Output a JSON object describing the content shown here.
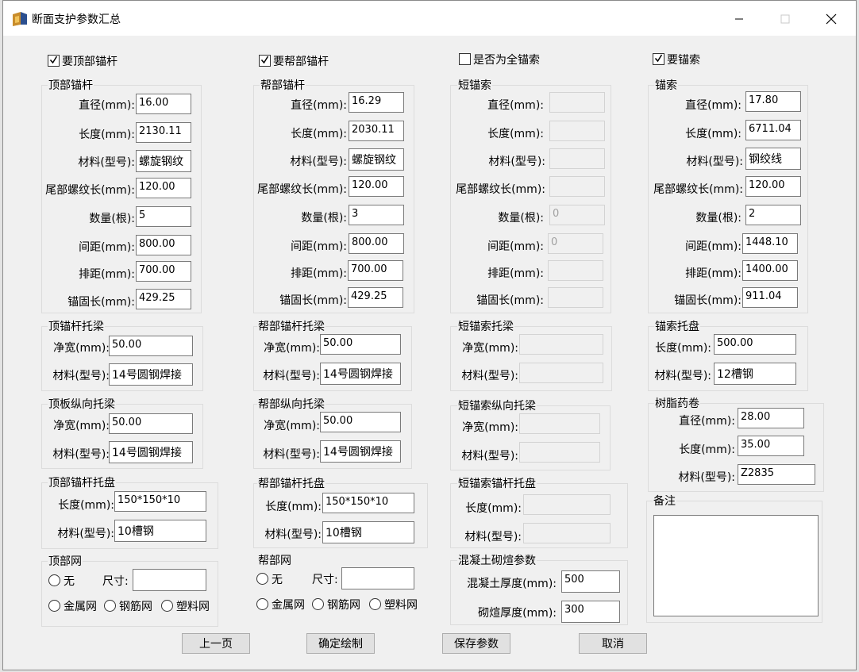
{
  "window": {
    "title": "断面支护参数汇总"
  },
  "checkboxes": {
    "top_bolt": {
      "label": "要顶部锚杆",
      "checked": true
    },
    "side_bolt": {
      "label": "要帮部锚杆",
      "checked": true
    },
    "full_cable": {
      "label": "是否为全锚索",
      "checked": false
    },
    "cable": {
      "label": "要锚索",
      "checked": true
    }
  },
  "top_bolt": {
    "title": "顶部锚杆",
    "labels": [
      "直径(mm):",
      "长度(mm):",
      "材料(型号):",
      "尾部螺纹长(mm):",
      "数量(根):",
      "间距(mm):",
      "排距(mm):",
      "锚固长(mm):"
    ],
    "values": [
      "16.00",
      "2130.11",
      "螺旋钢纹",
      "120.00",
      "5",
      "800.00",
      "700.00",
      "429.25"
    ]
  },
  "side_bolt": {
    "title": "帮部锚杆",
    "labels": [
      "直径(mm):",
      "长度(mm):",
      "材料(型号):",
      "尾部螺纹长(mm):",
      "数量(根):",
      "间距(mm):",
      "排距(mm):",
      "锚固长(mm):"
    ],
    "values": [
      "16.29",
      "2030.11",
      "螺旋钢纹",
      "120.00",
      "3",
      "800.00",
      "700.00",
      "429.25"
    ]
  },
  "short_cable": {
    "title": "短锚索",
    "labels": [
      "直径(mm):",
      "长度(mm):",
      "材料(型号):",
      "尾部螺纹长(mm):",
      "数量(根):",
      "间距(mm):",
      "排距(mm):",
      "锚固长(mm):"
    ],
    "values": [
      "",
      "",
      "",
      "",
      "0",
      "0",
      "",
      ""
    ]
  },
  "cable": {
    "title": "锚索",
    "labels": [
      "直径(mm):",
      "长度(mm):",
      "材料(型号):",
      "尾部螺纹长(mm):",
      "数量(根):",
      "间距(mm):",
      "排距(mm):",
      "锚固长(mm):"
    ],
    "values": [
      "17.80",
      "6711.04",
      "钢绞线",
      "120.00",
      "2",
      "1448.10",
      "1400.00",
      "911.04"
    ]
  },
  "top_beam": {
    "title": "顶锚杆托梁",
    "labels": [
      "净宽(mm):",
      "材料(型号):"
    ],
    "values": [
      "50.00",
      "14号圆钢焊接"
    ]
  },
  "side_beam": {
    "title": "帮部锚杆托梁",
    "labels": [
      "净宽(mm):",
      "材料(型号):"
    ],
    "values": [
      "50.00",
      "14号圆钢焊接"
    ]
  },
  "short_beam": {
    "title": "短锚索托梁",
    "labels": [
      "净宽(mm):",
      "材料(型号):"
    ],
    "values": [
      "",
      ""
    ]
  },
  "cable_plate": {
    "title": "锚索托盘",
    "labels": [
      "长度(mm):",
      "材料(型号):"
    ],
    "values": [
      "500.00",
      "12槽钢"
    ]
  },
  "top_long_beam": {
    "title": "顶板纵向托梁",
    "labels": [
      "净宽(mm):",
      "材料(型号):"
    ],
    "values": [
      "50.00",
      "14号圆钢焊接"
    ]
  },
  "side_long_beam": {
    "title": "帮部纵向托梁",
    "labels": [
      "净宽(mm):",
      "材料(型号):"
    ],
    "values": [
      "50.00",
      "14号圆钢焊接"
    ]
  },
  "short_long_beam": {
    "title": "短锚索纵向托梁",
    "labels": [
      "净宽(mm):",
      "材料(型号):"
    ],
    "values": [
      "",
      ""
    ]
  },
  "resin": {
    "title": "树脂药卷",
    "labels": [
      "直径(mm):",
      "长度(mm):",
      "材料(型号):"
    ],
    "values": [
      "28.00",
      "35.00",
      "Z2835"
    ]
  },
  "top_plate": {
    "title": "顶部锚杆托盘",
    "labels": [
      "长度(mm):",
      "材料(型号):"
    ],
    "values": [
      "150*150*10",
      "10槽钢"
    ]
  },
  "side_plate": {
    "title": "帮部锚杆托盘",
    "labels": [
      "长度(mm):",
      "材料(型号):"
    ],
    "values": [
      "150*150*10",
      "10槽钢"
    ]
  },
  "short_plate": {
    "title": "短锚索锚杆托盘",
    "labels": [
      "长度(mm):",
      "材料(型号):"
    ],
    "values": [
      "",
      ""
    ]
  },
  "remark": {
    "title": "备注",
    "value": ""
  },
  "top_mesh": {
    "title": "顶部网",
    "none": "无",
    "size_label": "尺寸:",
    "size_value": "",
    "metal": "金属网",
    "rebar": "钢筋网",
    "plastic": "塑料网"
  },
  "side_mesh": {
    "title": "帮部网",
    "none": "无",
    "size_label": "尺寸:",
    "size_value": "",
    "metal": "金属网",
    "rebar": "钢筋网",
    "plastic": "塑料网"
  },
  "concrete": {
    "title": "混凝土砌煊参数",
    "labels": [
      "混凝土厚度(mm):",
      "砌煊厚度(mm):"
    ],
    "values": [
      "500",
      "300"
    ]
  },
  "buttons": {
    "prev": "上一页",
    "confirm": "确定绘制",
    "save": "保存参数",
    "cancel": "取消"
  }
}
